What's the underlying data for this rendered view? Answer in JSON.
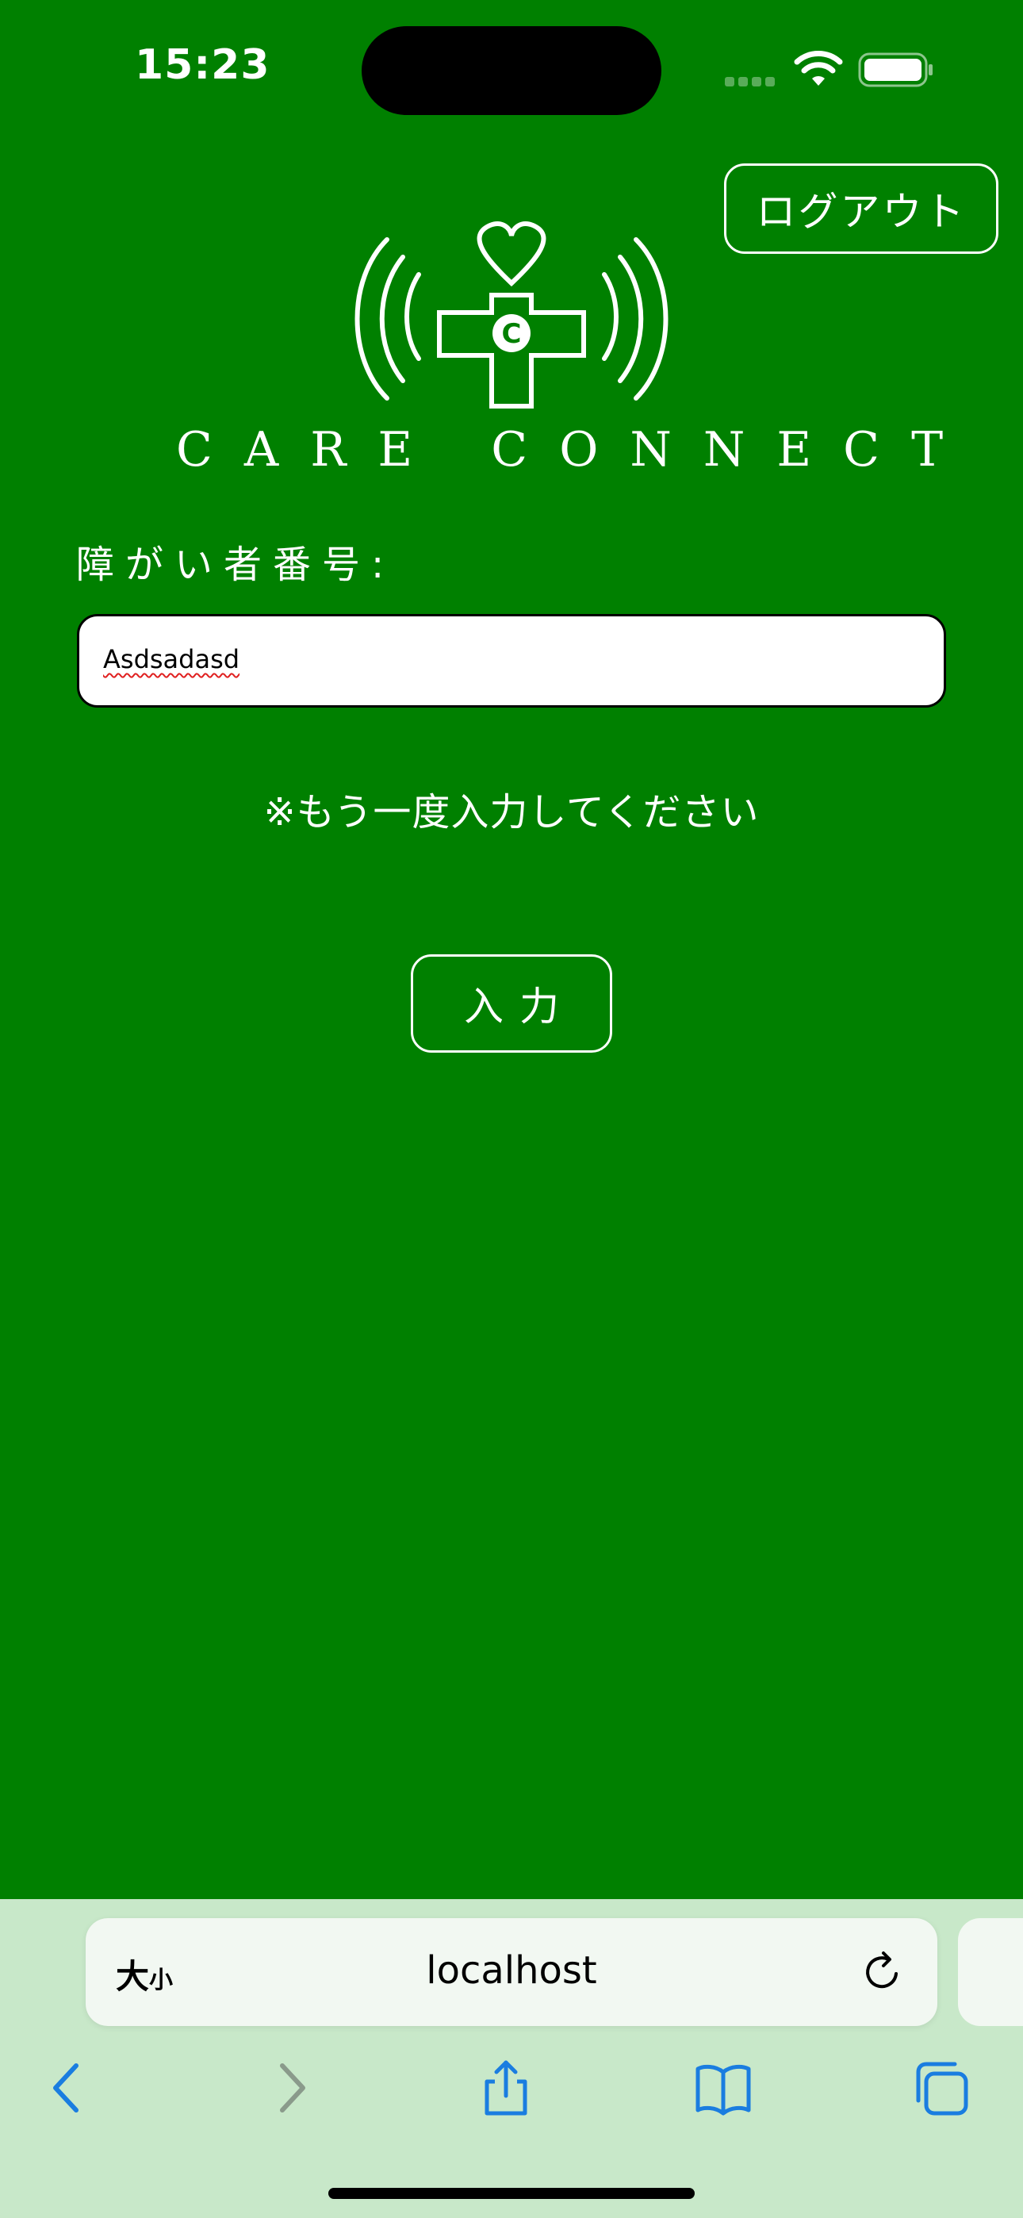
{
  "status_bar": {
    "time": "15:23"
  },
  "header": {
    "logout_label": "ログアウト"
  },
  "logo": {
    "emblem_letter": "C",
    "brand_name": "CARE CONNECT"
  },
  "form": {
    "label": "障がい者番号:",
    "input_value": "Asdsadasd",
    "error_message": "※もう一度入力してください",
    "submit_label": "入力"
  },
  "browser": {
    "text_size_label_big": "大",
    "text_size_label_small": "小",
    "url": "localhost"
  },
  "colors": {
    "background": "#008000",
    "foreground": "#ffffff",
    "browser_bar": "#c8e8c9",
    "toolbar_accent": "#1a7de0"
  },
  "icons": {
    "status": [
      "cellular-signal-icon",
      "wifi-icon",
      "battery-icon"
    ],
    "address_bar": [
      "text-size-icon",
      "reload-icon"
    ],
    "toolbar": [
      "back-icon",
      "forward-icon",
      "share-icon",
      "bookmarks-icon",
      "tabs-icon"
    ]
  }
}
